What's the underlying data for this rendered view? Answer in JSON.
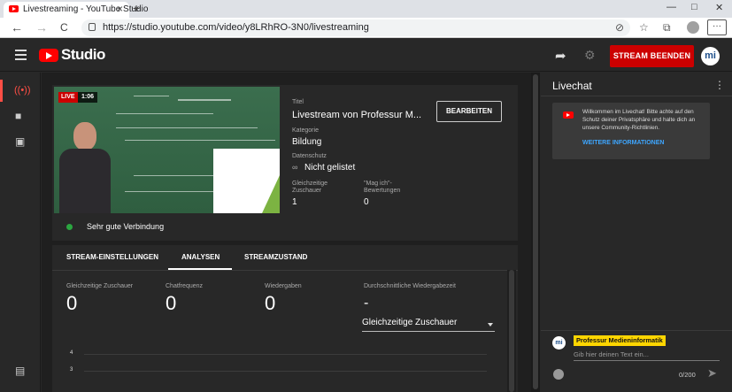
{
  "browser": {
    "tab_title": "Livestreaming - YouTube Studio",
    "tab_close": "×",
    "new_tab": "+",
    "url": "https://studio.youtube.com/video/y8LRhRO-3N0/livestreaming",
    "back": "←",
    "forward": "→",
    "reload": "C",
    "menu": "···",
    "win_min": "—",
    "win_max": "□",
    "win_close": "✕"
  },
  "header": {
    "logo_text": "Studio",
    "end_stream": "STREAM BEENDEN",
    "channel_initials": "mi"
  },
  "preview": {
    "live_badge": "LIVE",
    "elapsed": "1:06",
    "title_label": "Titel",
    "title_value": "Livestream von Professur M...",
    "edit_button": "BEARBEITEN",
    "category_label": "Kategorie",
    "category_value": "Bildung",
    "privacy_label": "Datenschutz",
    "privacy_value": "Nicht gelistet",
    "concurrent_label_1": "Gleichzeitige",
    "concurrent_label_2": "Zuschauer",
    "concurrent_value": "1",
    "likes_label_1": "\"Mag ich\"-",
    "likes_label_2": "Bewertungen",
    "likes_value": "0",
    "connection": "Sehr gute Verbindung"
  },
  "tabs": [
    {
      "label": "STREAM-EINSTELLUNGEN"
    },
    {
      "label": "ANALYSEN"
    },
    {
      "label": "STREAMZUSTAND"
    }
  ],
  "metrics": [
    {
      "label": "Gleichzeitige Zuschauer",
      "value": "0"
    },
    {
      "label": "Chatfrequenz",
      "value": "0"
    },
    {
      "label": "Wiedergaben",
      "value": "0"
    },
    {
      "label": "Durchschnittliche Wiedergabezeit",
      "value": "-"
    }
  ],
  "dropdown": {
    "selected": "Gleichzeitige Zuschauer"
  },
  "chart_data": {
    "type": "line",
    "title": "",
    "xlabel": "",
    "ylabel": "",
    "y_ticks": [
      "4",
      "3"
    ],
    "series": []
  },
  "chat": {
    "title": "Livechat",
    "welcome_text": "Willkommen im Livechat! Bitte achte auf den Schutz deiner Privatsphäre und halte dich an unsere Community-Richtlinien.",
    "welcome_link": "WEITERE INFORMATIONEN",
    "user_name": "Professur Medieninformatik",
    "user_initials": "mi",
    "input_placeholder": "Gib hier deinen Text ein...",
    "counter": "0/200"
  },
  "colors": {
    "accent_red": "#cc0000",
    "link_blue": "#3ea6ff",
    "owner_badge": "#ffd600",
    "connection_green": "#2ba640"
  },
  "icons": [
    "hamburger-icon",
    "youtube-logo-icon",
    "clapperboard-icon",
    "bookmark-icon",
    "share-icon",
    "settings-icon",
    "live-icon",
    "camera-icon",
    "calendar-icon",
    "feedback-icon",
    "more-vert-icon",
    "emoji-icon",
    "send-icon",
    "link-icon"
  ]
}
